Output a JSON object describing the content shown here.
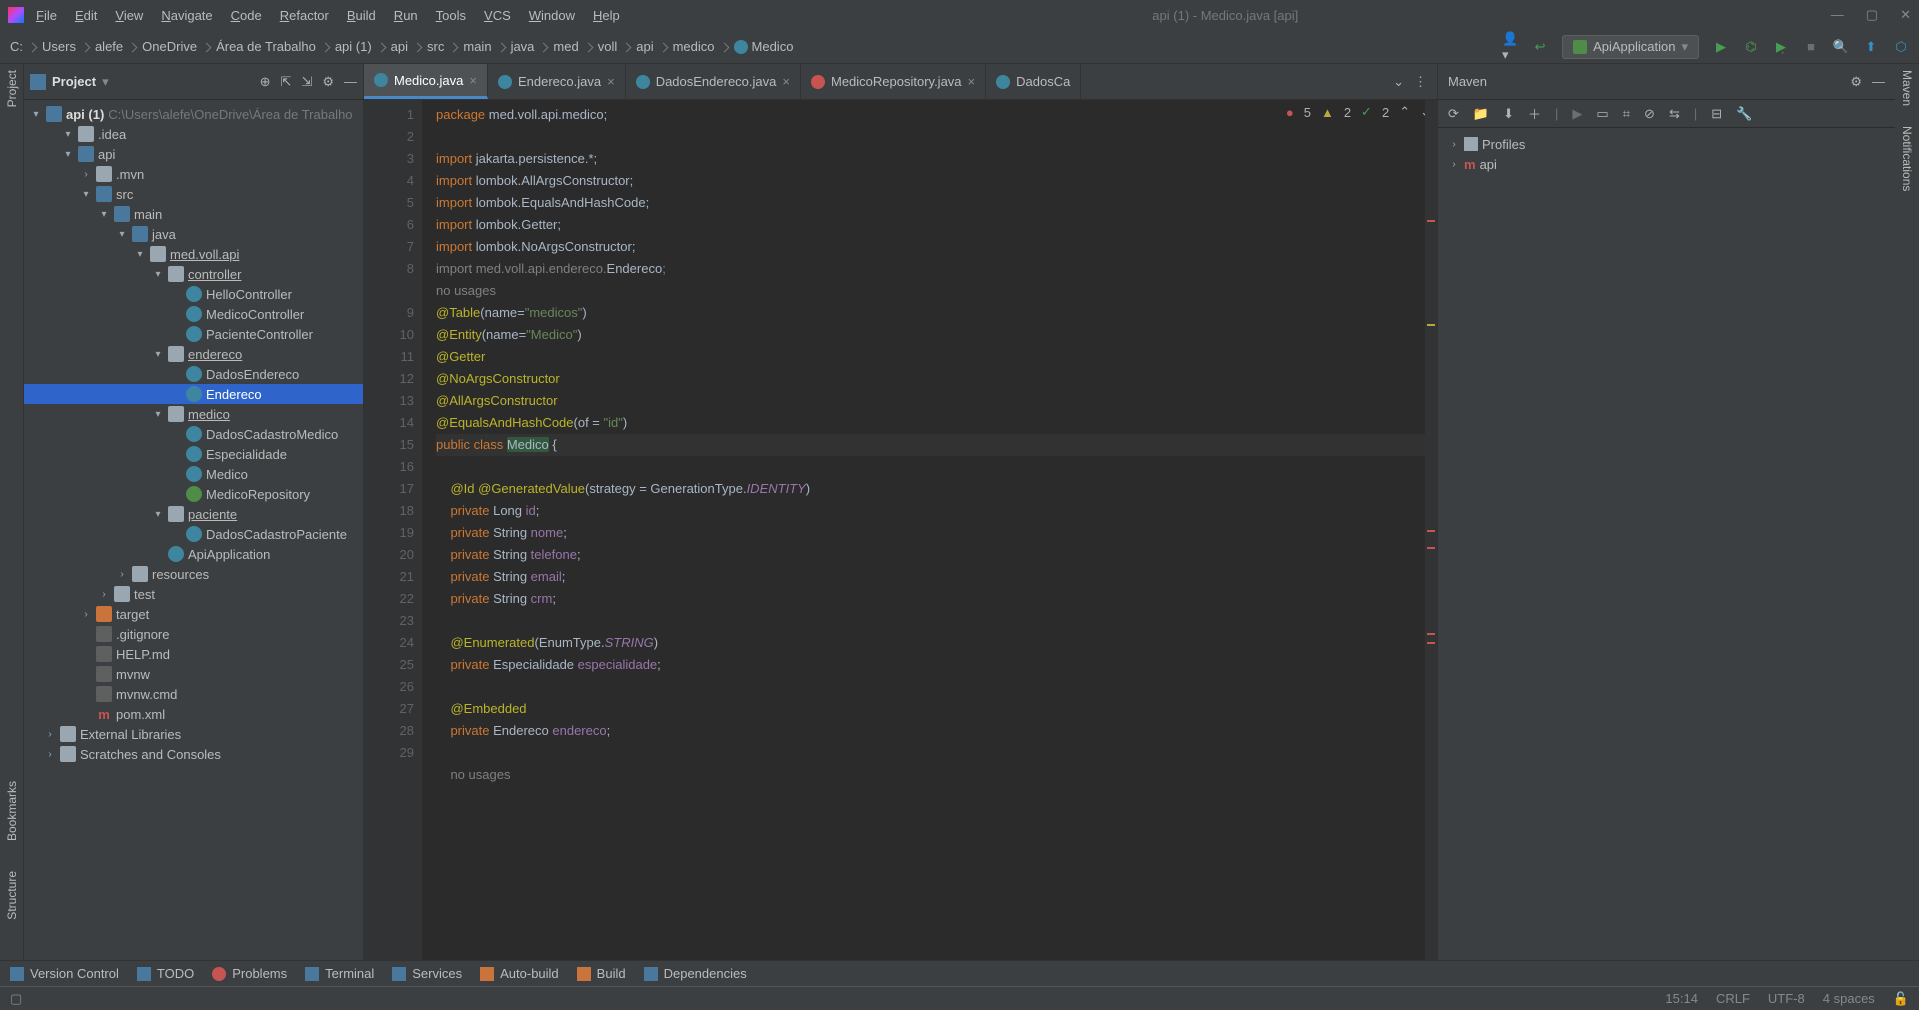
{
  "window": {
    "title": "api (1) - Medico.java [api]"
  },
  "menu": [
    "File",
    "Edit",
    "View",
    "Navigate",
    "Code",
    "Refactor",
    "Build",
    "Run",
    "Tools",
    "VCS",
    "Window",
    "Help"
  ],
  "breadcrumbs": [
    "C:",
    "Users",
    "alefe",
    "OneDrive",
    "Área de Trabalho",
    "api (1)",
    "api",
    "src",
    "main",
    "java",
    "med",
    "voll",
    "api",
    "medico",
    "Medico"
  ],
  "run_config": "ApiApplication",
  "project": {
    "title": "Project",
    "root_name": "api (1)",
    "root_path": "C:\\Users\\alefe\\OneDrive\\Área de Trabalho",
    "tree": [
      {
        "d": 1,
        "arrow": "▾",
        "ico": "folder",
        "label": ".idea"
      },
      {
        "d": 1,
        "arrow": "▾",
        "ico": "folder-blue",
        "label": "api",
        "bold": true
      },
      {
        "d": 2,
        "arrow": "›",
        "ico": "folder",
        "label": ".mvn"
      },
      {
        "d": 2,
        "arrow": "▾",
        "ico": "folder-blue",
        "label": "src"
      },
      {
        "d": 3,
        "arrow": "▾",
        "ico": "folder-blue",
        "label": "main"
      },
      {
        "d": 4,
        "arrow": "▾",
        "ico": "folder-blue",
        "label": "java"
      },
      {
        "d": 5,
        "arrow": "▾",
        "ico": "pkg",
        "label": "med.voll.api",
        "u": true
      },
      {
        "d": 6,
        "arrow": "▾",
        "ico": "pkg",
        "label": "controller",
        "u": true
      },
      {
        "d": 7,
        "arrow": "",
        "ico": "java",
        "label": "HelloController"
      },
      {
        "d": 7,
        "arrow": "",
        "ico": "java",
        "label": "MedicoController"
      },
      {
        "d": 7,
        "arrow": "",
        "ico": "java",
        "label": "PacienteController"
      },
      {
        "d": 6,
        "arrow": "▾",
        "ico": "pkg",
        "label": "endereco",
        "u": true
      },
      {
        "d": 7,
        "arrow": "",
        "ico": "java",
        "label": "DadosEndereco"
      },
      {
        "d": 7,
        "arrow": "",
        "ico": "java",
        "label": "Endereco",
        "sel": true
      },
      {
        "d": 6,
        "arrow": "▾",
        "ico": "pkg",
        "label": "medico",
        "u": true
      },
      {
        "d": 7,
        "arrow": "",
        "ico": "java",
        "label": "DadosCadastroMedico"
      },
      {
        "d": 7,
        "arrow": "",
        "ico": "java",
        "label": "Especialidade"
      },
      {
        "d": 7,
        "arrow": "",
        "ico": "java",
        "label": "Medico"
      },
      {
        "d": 7,
        "arrow": "",
        "ico": "interface",
        "label": "MedicoRepository"
      },
      {
        "d": 6,
        "arrow": "▾",
        "ico": "pkg",
        "label": "paciente",
        "u": true
      },
      {
        "d": 7,
        "arrow": "",
        "ico": "java",
        "label": "DadosCadastroPaciente"
      },
      {
        "d": 6,
        "arrow": "",
        "ico": "java",
        "label": "ApiApplication"
      },
      {
        "d": 4,
        "arrow": "›",
        "ico": "folder",
        "label": "resources"
      },
      {
        "d": 3,
        "arrow": "›",
        "ico": "folder",
        "label": "test"
      },
      {
        "d": 2,
        "arrow": "›",
        "ico": "folder-orange",
        "label": "target"
      },
      {
        "d": 2,
        "arrow": "",
        "ico": "gfile",
        "label": ".gitignore"
      },
      {
        "d": 2,
        "arrow": "",
        "ico": "gfile",
        "label": "HELP.md"
      },
      {
        "d": 2,
        "arrow": "",
        "ico": "gfile",
        "label": "mvnw"
      },
      {
        "d": 2,
        "arrow": "",
        "ico": "gfile",
        "label": "mvnw.cmd"
      },
      {
        "d": 2,
        "arrow": "",
        "ico": "mvn",
        "label": "pom.xml"
      },
      {
        "d": 0,
        "arrow": "›",
        "ico": "root",
        "label": "External Libraries"
      },
      {
        "d": 0,
        "arrow": "›",
        "ico": "root",
        "label": "Scratches and Consoles"
      }
    ]
  },
  "tabs": [
    {
      "label": "Medico.java",
      "active": true,
      "ico": "java"
    },
    {
      "label": "Endereco.java",
      "ico": "java"
    },
    {
      "label": "DadosEndereco.java",
      "ico": "java"
    },
    {
      "label": "MedicoRepository.java",
      "ico": "red"
    },
    {
      "label": "DadosCa",
      "ico": "java",
      "trunc": true
    }
  ],
  "inspections": {
    "errors": "5",
    "warnings": "2",
    "weak": "2"
  },
  "code_lines": [
    {
      "n": 1,
      "html": "<span class='k'>package</span> med.voll.api.medico;"
    },
    {
      "n": 2,
      "html": ""
    },
    {
      "n": 3,
      "html": "<span class='k'>import</span> jakarta.persistence.*;"
    },
    {
      "n": 4,
      "html": "<span class='k'>import</span> lombok.<span class='t'>AllArgsConstructor</span>;"
    },
    {
      "n": 5,
      "html": "<span class='k'>import</span> lombok.<span class='t'>EqualsAndHashCode</span>;"
    },
    {
      "n": 6,
      "html": "<span class='k'>import</span> lombok.<span class='t'>Getter</span>;"
    },
    {
      "n": 7,
      "html": "<span class='k'>import</span> lombok.<span class='t'>NoArgsConstructor</span>;"
    },
    {
      "n": 8,
      "html": "<span class='c'>import med.voll.api.endereco.</span><span class='t'>Endereco</span><span class='c'>;</span>"
    },
    {
      "n": "",
      "html": "<span class='c'>no usages</span>"
    },
    {
      "n": 9,
      "html": "<span class='an'>@Table</span>(name=<span class='s'>\"medicos\"</span>)"
    },
    {
      "n": 10,
      "html": "<span class='an'>@Entity</span>(name=<span class='s'>\"Medico\"</span>)"
    },
    {
      "n": 11,
      "html": "<span class='an'>@Getter</span>"
    },
    {
      "n": 12,
      "html": "<span class='an'>@NoArgsConstructor</span>"
    },
    {
      "n": 13,
      "html": "<span class='an'>@AllArgsConstructor</span>"
    },
    {
      "n": 14,
      "html": "<span class='an'>@EqualsAndHashCode</span>(of = <span class='s'>\"id\"</span>)"
    },
    {
      "n": 15,
      "html": "<span class='k'>public class</span> <span class='hl'>Medico</span> {",
      "cur": true
    },
    {
      "n": 16,
      "html": ""
    },
    {
      "n": 17,
      "html": "    <span class='an'>@Id</span> <span class='an'>@GeneratedValue</span>(strategy = GenerationType.<span class='it'>IDENTITY</span>)"
    },
    {
      "n": 18,
      "html": "    <span class='k'>private</span> Long <span class='f'>id</span>;"
    },
    {
      "n": 19,
      "html": "    <span class='k'>private</span> String <span class='f'>nome</span>;"
    },
    {
      "n": 20,
      "html": "    <span class='k'>private</span> String <span class='f'>telefone</span>;"
    },
    {
      "n": 21,
      "html": "    <span class='k'>private</span> String <span class='f'>email</span>;"
    },
    {
      "n": 22,
      "html": "    <span class='k'>private</span> String <span class='f'>crm</span>;"
    },
    {
      "n": 23,
      "html": ""
    },
    {
      "n": 24,
      "html": "    <span class='an'>@Enumerated</span>(EnumType.<span class='it'>STRING</span>)"
    },
    {
      "n": 25,
      "html": "    <span class='k'>private</span> Especialidade <span class='f'>especialidade</span>;"
    },
    {
      "n": 26,
      "html": ""
    },
    {
      "n": 27,
      "html": "    <span class='an'>@Embedded</span>"
    },
    {
      "n": 28,
      "html": "    <span class='k'>private</span> <span class='t'>Endereco</span> <span class='f'>endereco</span>;"
    },
    {
      "n": 29,
      "html": ""
    },
    {
      "n": "",
      "html": "    <span class='c'>no usages</span>"
    }
  ],
  "maven": {
    "title": "Maven",
    "profiles": "Profiles",
    "api": "api"
  },
  "bottom_tabs": [
    "Version Control",
    "TODO",
    "Problems",
    "Terminal",
    "Services",
    "Auto-build",
    "Build",
    "Dependencies"
  ],
  "status": {
    "pos": "15:14",
    "crlf": "CRLF",
    "enc": "UTF-8",
    "indent": "4 spaces"
  },
  "leftstrip": [
    "Project",
    "Bookmarks",
    "Structure"
  ],
  "rightstrip": [
    "Maven",
    "Notifications"
  ]
}
